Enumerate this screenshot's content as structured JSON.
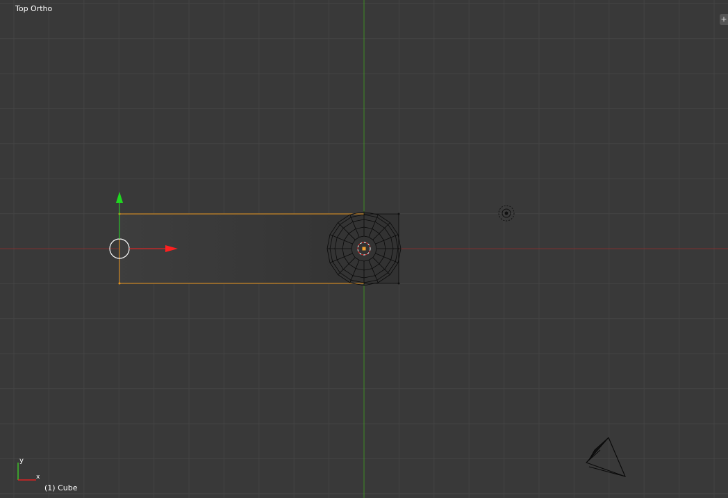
{
  "viewport": {
    "view_title": "Top Ortho",
    "object_info": "(1) Cube",
    "axis_widget": {
      "y_label": "y",
      "x_label": "x"
    },
    "corner_widget_icon": "plus-icon"
  },
  "colors": {
    "background": "#393939",
    "grid_minor": "#424242",
    "grid_major": "#4a4a4a",
    "x_axis": "#8a2a2a",
    "y_axis": "#3a8f2a",
    "selected_outline": "#e2901c",
    "manipulator_x": "#ff2020",
    "manipulator_y": "#20d820",
    "wireframe": "#000000"
  }
}
